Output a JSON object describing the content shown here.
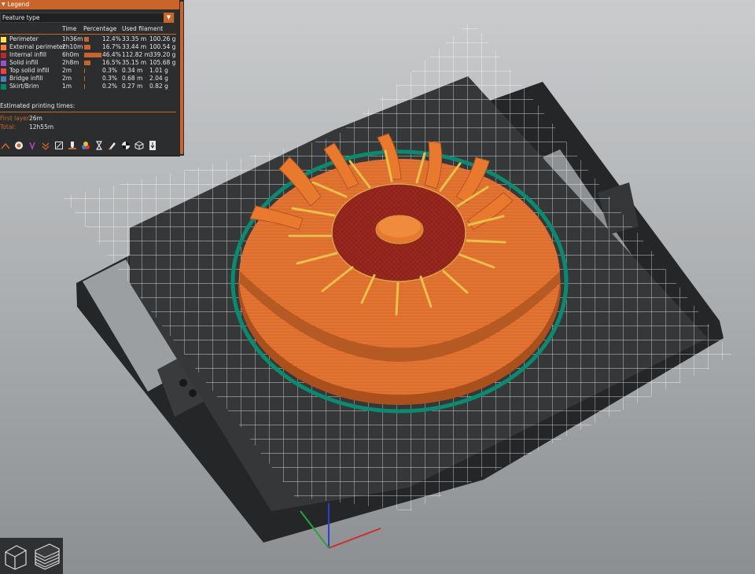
{
  "legend": {
    "title": "Legend",
    "selector_value": "Feature type",
    "columns": [
      "Time",
      "Percentage",
      "Used filament"
    ],
    "rows": [
      {
        "name": "Perimeter",
        "color": "#ffe64d",
        "time": "1h36m",
        "percent": "12.4%",
        "length": "33.35 m",
        "weight": "100.26 g",
        "fraction": 0.124
      },
      {
        "name": "External perimeter",
        "color": "#ff7d38",
        "time": "2h10m",
        "percent": "16.7%",
        "length": "33.44 m",
        "weight": "100.54 g",
        "fraction": 0.167
      },
      {
        "name": "Internal infill",
        "color": "#b03029",
        "time": "6h0m",
        "percent": "46.4%",
        "length": "112.82 m",
        "weight": "339.20 g",
        "fraction": 0.464
      },
      {
        "name": "Solid infill",
        "color": "#9654cc",
        "time": "2h8m",
        "percent": "16.5%",
        "length": "35.15 m",
        "weight": "105.68 g",
        "fraction": 0.165
      },
      {
        "name": "Top solid infill",
        "color": "#f04040",
        "time": "2m",
        "percent": "0.3%",
        "length": "0.34 m",
        "weight": "1.01 g",
        "fraction": 0.003
      },
      {
        "name": "Bridge infill",
        "color": "#4d80ba",
        "time": "2m",
        "percent": "0.3%",
        "length": "0.68 m",
        "weight": "2.04 g",
        "fraction": 0.003
      },
      {
        "name": "Skirt/Brim",
        "color": "#00876e",
        "time": "1m",
        "percent": "0.2%",
        "length": "0.27 m",
        "weight": "0.82 g",
        "fraction": 0.002
      }
    ],
    "estimated_title": "Estimated printing times:",
    "first_layer_label": "First layer:",
    "first_layer_value": "26m",
    "total_label": "Total:",
    "total_value": "12h55m",
    "toolbar_icons": [
      "travel-icon",
      "wipe-icon",
      "retractions-icon",
      "deretractions-icon",
      "seams-icon",
      "tool-changes-icon",
      "color-changes-icon",
      "pause-prints-icon",
      "custom-gcodes-icon",
      "center-of-gravity-icon",
      "shells-icon",
      "tool-marker-icon"
    ]
  },
  "colors": {
    "accent": "#c9652b",
    "panel_bg": "#2c2d2e",
    "print_orange": "#e8752f",
    "print_infill": "#8e1f18",
    "skirt": "#00876e",
    "bed_dark": "#2a2b2c"
  },
  "view_buttons": [
    "3d-view-icon",
    "layers-view-icon"
  ]
}
